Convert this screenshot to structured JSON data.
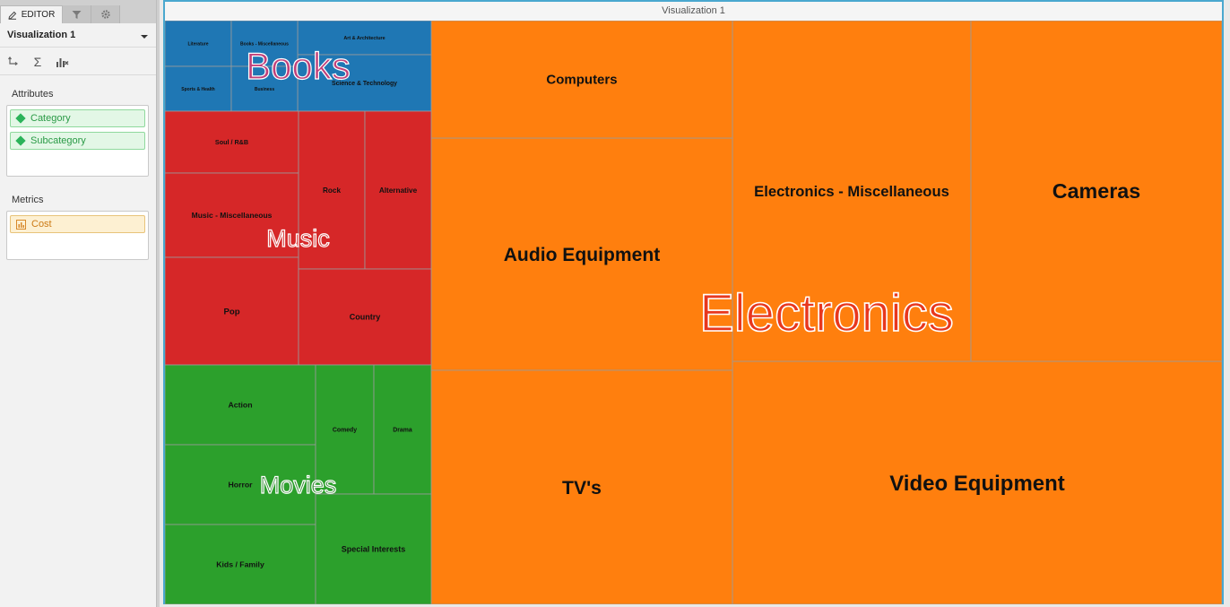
{
  "tabs": {
    "editor_label": "EDITOR",
    "filter_icon": "filter-icon",
    "settings_icon": "gear-icon"
  },
  "visualization_selector": {
    "value": "Visualization 1"
  },
  "toolbar": {
    "swap_icon": "swap-axes-icon",
    "sum_icon": "sigma-icon",
    "sum_glyph": "Σ",
    "chart_icon": "chart-type-icon"
  },
  "attributes": {
    "label": "Attributes",
    "items": [
      "Category",
      "Subcategory"
    ]
  },
  "metrics": {
    "label": "Metrics",
    "items": [
      "Cost"
    ]
  },
  "visualization": {
    "title": "Visualization 1"
  },
  "colors": {
    "Electronics": "#ff7f0e",
    "Books": "#1f77b4",
    "Music": "#d62728",
    "Movies": "#2ca02c",
    "accent": "#4aa8cf"
  },
  "chart_data": {
    "type": "treemap",
    "metric": "Cost",
    "groups": [
      {
        "name": "Electronics",
        "children": [
          {
            "name": "Video Equipment",
            "value": 158
          },
          {
            "name": "Electronics - Miscellaneous",
            "value": 108
          },
          {
            "name": "Cameras",
            "value": 114
          },
          {
            "name": "Audio Equipment",
            "value": 93
          },
          {
            "name": "TV's",
            "value": 94
          },
          {
            "name": "Computers",
            "value": 47
          }
        ]
      },
      {
        "name": "Movies",
        "children": [
          {
            "name": "Action",
            "value": 16
          },
          {
            "name": "Horror",
            "value": 16
          },
          {
            "name": "Kids / Family",
            "value": 16
          },
          {
            "name": "Comedy",
            "value": 10
          },
          {
            "name": "Drama",
            "value": 10
          },
          {
            "name": "Special Interests",
            "value": 17
          }
        ]
      },
      {
        "name": "Music",
        "children": [
          {
            "name": "Soul / R&B",
            "value": 11
          },
          {
            "name": "Music - Miscellaneous",
            "value": 15
          },
          {
            "name": "Pop",
            "value": 19
          },
          {
            "name": "Rock",
            "value": 14
          },
          {
            "name": "Alternative",
            "value": 14
          },
          {
            "name": "Country",
            "value": 17
          }
        ]
      },
      {
        "name": "Books",
        "children": [
          {
            "name": "Art & Architecture",
            "value": 6
          },
          {
            "name": "Science & Technology",
            "value": 10
          },
          {
            "name": "Literature",
            "value": 4
          },
          {
            "name": "Books - Miscellaneous",
            "value": 4
          },
          {
            "name": "Sports & Health",
            "value": 4
          },
          {
            "name": "Business",
            "value": 4
          }
        ]
      }
    ]
  }
}
